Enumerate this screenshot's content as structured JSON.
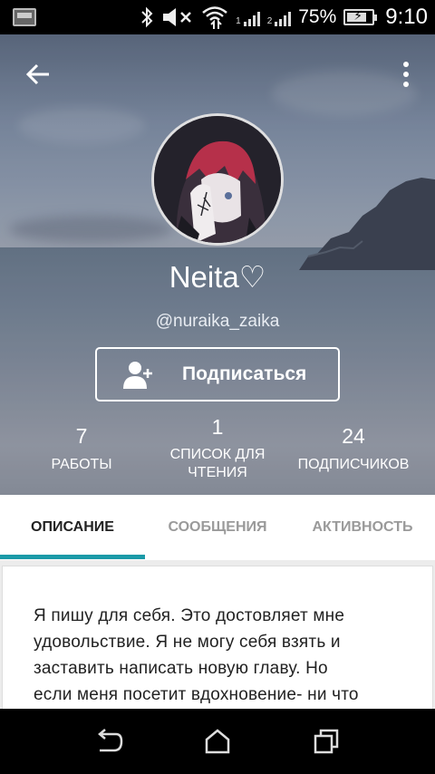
{
  "status_bar": {
    "battery_percent": "75%",
    "time": "9:10",
    "sim1_label": "1",
    "sim2_label": "2"
  },
  "profile": {
    "display_name": "Neita♡",
    "handle": "@nuraika_zaika",
    "follow_label": "Подписаться"
  },
  "stats": [
    {
      "value": "7",
      "label_line1": "РАБОТЫ",
      "label_line2": ""
    },
    {
      "value": "1",
      "label_line1": "СПИСОК ДЛЯ",
      "label_line2": "ЧТЕНИЯ"
    },
    {
      "value": "24",
      "label_line1": "ПОДПИСЧИКОВ",
      "label_line2": ""
    }
  ],
  "tabs": [
    {
      "label": "ОПИСАНИЕ",
      "active": true
    },
    {
      "label": "СООБЩЕНИЯ",
      "active": false
    },
    {
      "label": "АКТИВНОСТЬ",
      "active": false
    }
  ],
  "description": {
    "lines": [
      "Я пишу для себя. Это достовляет мне",
      "удовольствие. Я не могу себя взять и",
      "заставить написать новую главу. Но",
      "если меня посетит вдохновение- ни что"
    ]
  },
  "colors": {
    "accent": "#1b9aa8",
    "tab_active": "#222222",
    "tab_inactive": "#9a9a9a"
  },
  "icons": {
    "back": "arrow-left-icon",
    "more": "more-vertical-icon",
    "follow": "add-user-icon",
    "nav_back": "nav-back-icon",
    "nav_home": "nav-home-icon",
    "nav_recents": "nav-recents-icon"
  }
}
